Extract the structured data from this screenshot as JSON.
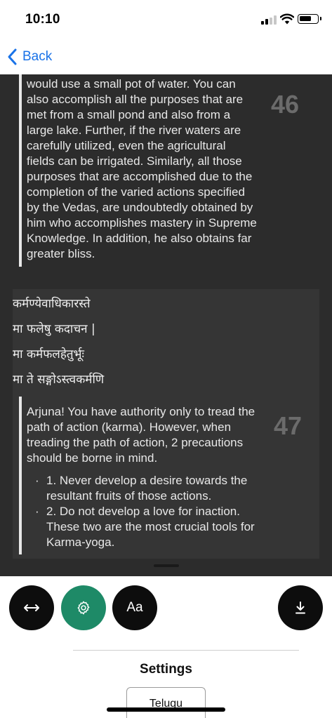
{
  "status_bar": {
    "time": "10:10",
    "battery_percent": 70
  },
  "nav": {
    "back_label": "Back"
  },
  "verse_46": {
    "number": "46",
    "lines": [
      "would use a small pot of water. You can",
      "also accomplish all the purposes that are",
      "met from a small pond and also from a",
      "large lake. Further, if the river waters are",
      "carefully utilized, even the agricultural",
      "fields can be irrigated. Similarly, all those",
      "purposes that are accomplished due to the",
      "completion of the varied actions specified",
      "by the Vedas, are undoubtedly obtained by",
      "him who accomplishes mastery in Supreme",
      "Knowledge. In addition, he also obtains far",
      "greater bliss."
    ]
  },
  "verse_47": {
    "number": "47",
    "sloka": [
      "कर्मण्येवाधिकारस्ते",
      "मा फलेषु कदाचन |",
      "मा कर्मफलहेतुर्भूः",
      "मा ते सङ्गोऽस्त्वकर्मणि"
    ],
    "lines": [
      "Arjuna! You have authority only to tread the",
      "path of action (karma). However, when",
      "treading the path of action, 2 precautions",
      "should be borne in mind."
    ],
    "bullets": [
      {
        "marker": "·",
        "lines": [
          "1. Never develop a desire towards the",
          "resultant fruits of those actions."
        ]
      },
      {
        "marker": "·",
        "lines": [
          "2. Do not develop a love for inaction.",
          "These two are the most crucial tools for",
          "Karma-yoga."
        ]
      }
    ]
  },
  "controls": {
    "width_icon": "arrows-horizontal-icon",
    "settings_icon": "gear-icon",
    "font_label": "Aa",
    "download_icon": "download-icon"
  },
  "settings": {
    "title": "Settings",
    "language": "Telugu"
  },
  "colors": {
    "accent_blue": "#1a73e8",
    "settings_green": "#1e8a67",
    "reader_bg": "#2c2c2c"
  }
}
